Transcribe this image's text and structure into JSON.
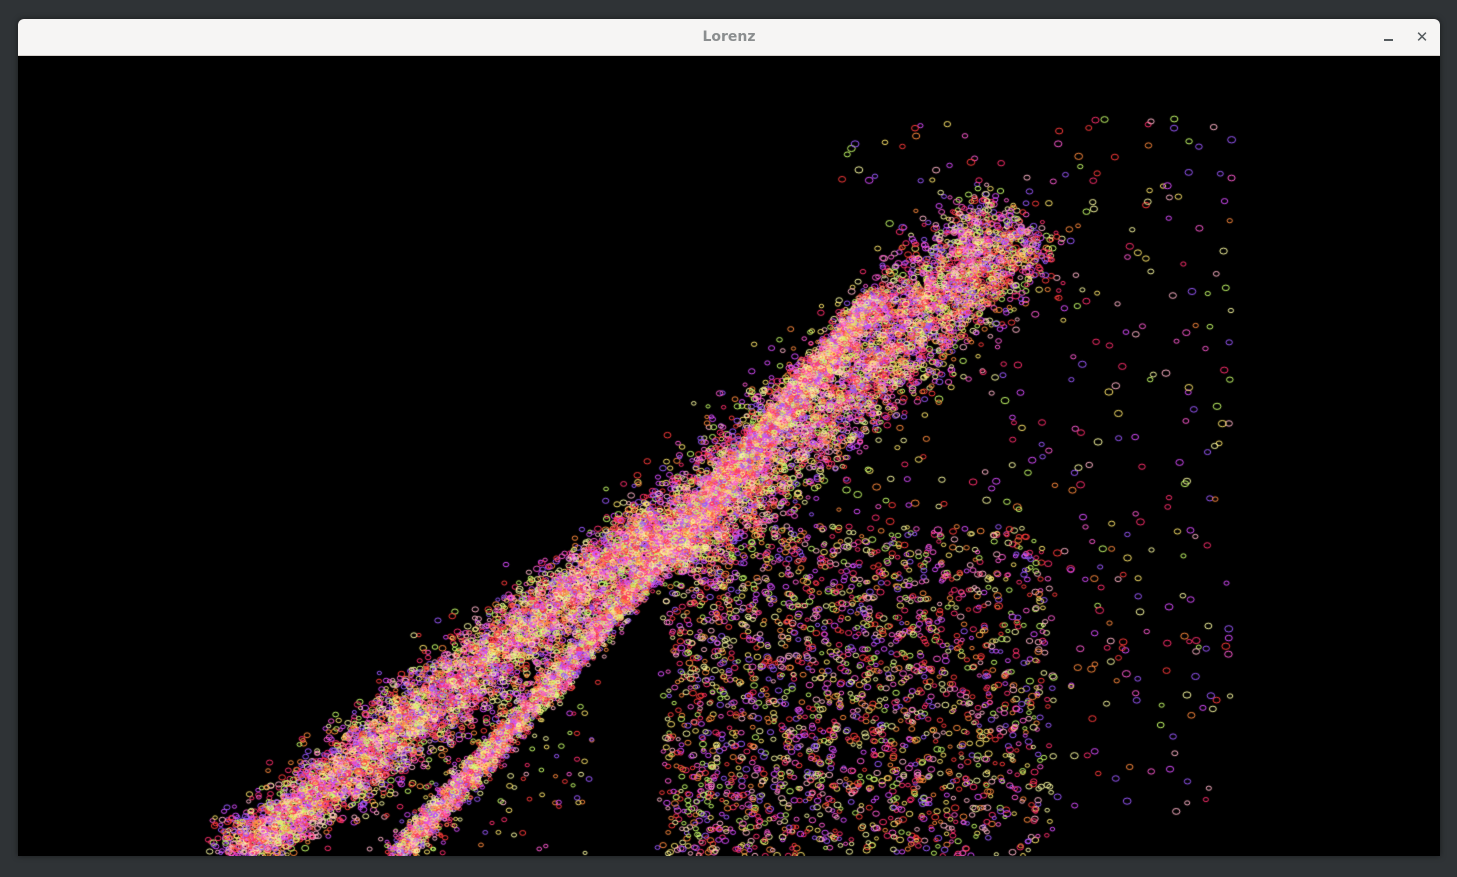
{
  "window": {
    "title": "Lorenz",
    "minimize_glyph": "minimize-icon",
    "close_glyph": "✕"
  },
  "scene": {
    "background": "#000000",
    "particle_shape": "small-ring",
    "palette": [
      "#ff2f6d",
      "#ff5ad2",
      "#d94cff",
      "#9b59ff",
      "#ffe66b",
      "#c8ff6a",
      "#ff8a3d",
      "#ffb3c8",
      "#ff3b3b",
      "#f9f9a0"
    ]
  }
}
